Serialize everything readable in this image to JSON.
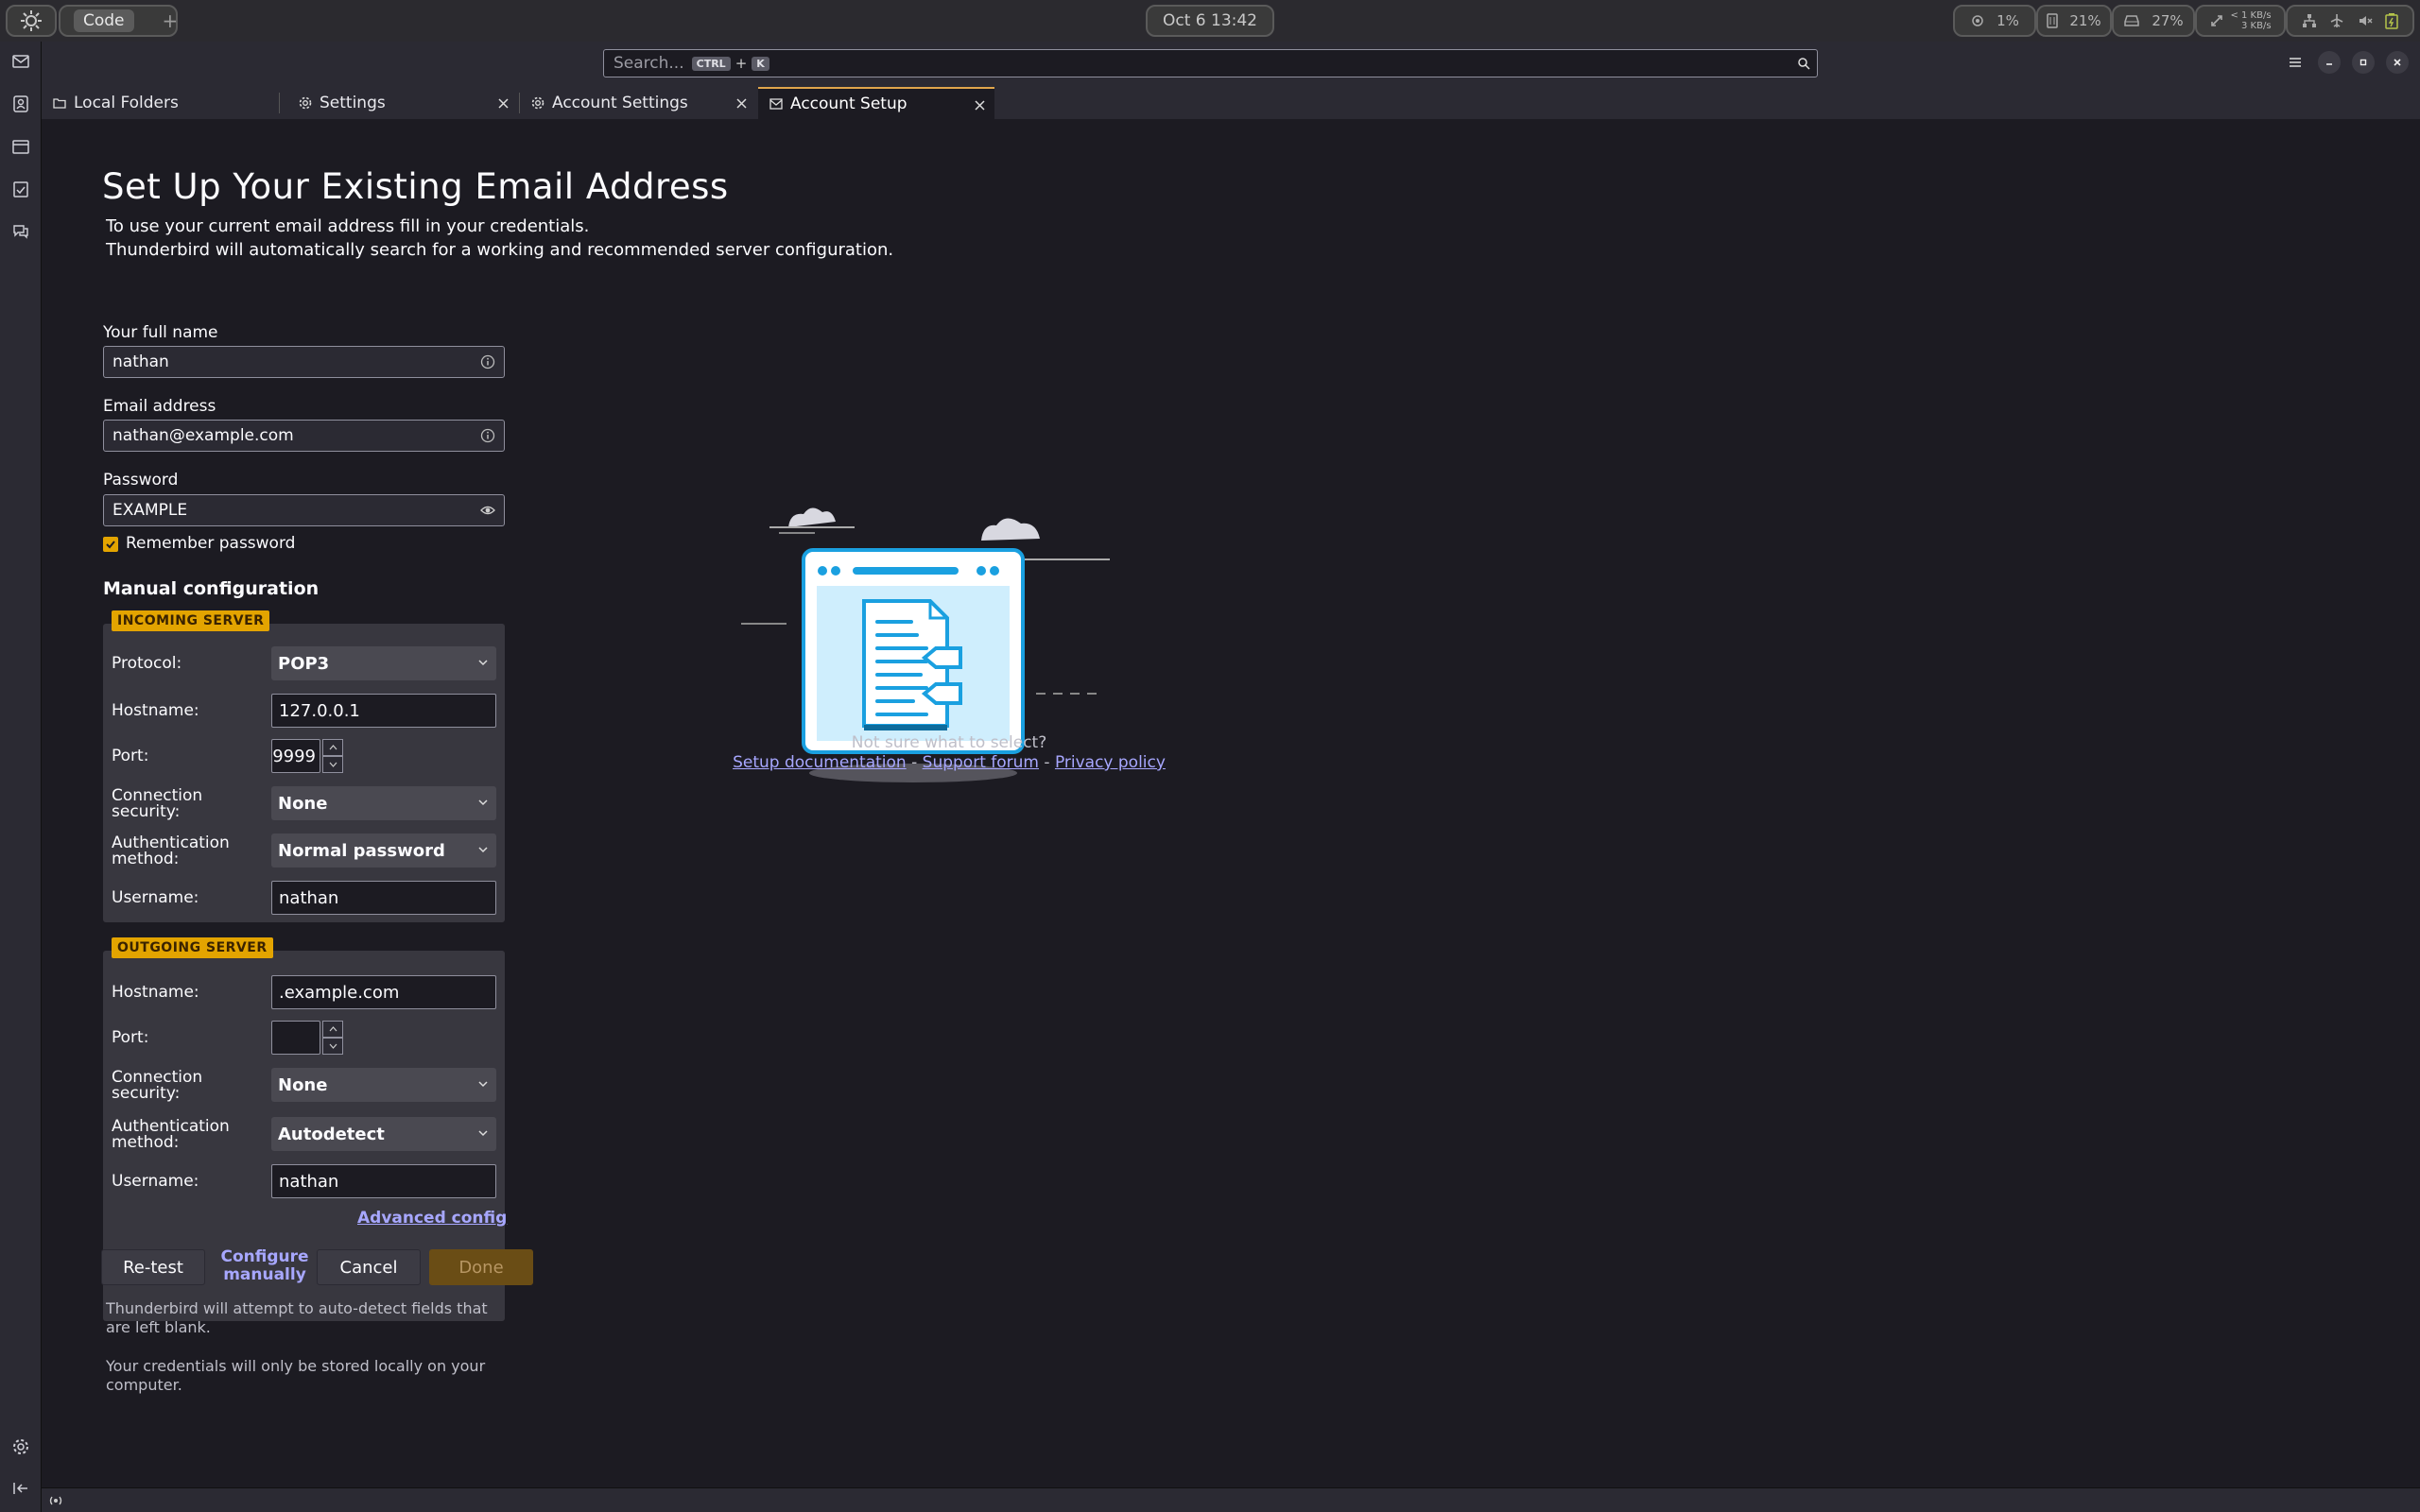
{
  "system_bar": {
    "workspace_label": "Code",
    "workspace_add": "+",
    "clock": "Oct 6  13:42",
    "cpu": "1%",
    "memory": "21%",
    "disk": "27%",
    "net_up": "< 1 KB/s",
    "net_down": "3 KB/s"
  },
  "search": {
    "placeholder": "Search...",
    "key1": "CTRL",
    "plus": "+",
    "key2": "K"
  },
  "tabs": [
    {
      "label": "Local Folders",
      "icon": "folder-icon"
    },
    {
      "label": "Settings",
      "icon": "gear-icon"
    },
    {
      "label": "Account Settings",
      "icon": "account-settings-icon"
    },
    {
      "label": "Account Setup",
      "icon": "mail-icon"
    }
  ],
  "page": {
    "title": "Set Up Your Existing Email Address",
    "intro_line1": "To use your current email address fill in your credentials.",
    "intro_line2": "Thunderbird will automatically search for a working and recommended server configuration."
  },
  "form": {
    "full_name_label": "Your full name",
    "full_name_value": "nathan",
    "email_label": "Email address",
    "email_value": "nathan@example.com",
    "password_label": "Password",
    "password_value": "EXAMPLE",
    "remember_label": "Remember password",
    "remember_checked": true
  },
  "manual": {
    "title": "Manual configuration",
    "incoming": {
      "badge": "INCOMING SERVER",
      "protocol_label": "Protocol:",
      "protocol_value": "POP3",
      "hostname_label": "Hostname:",
      "hostname_value": "127.0.0.1",
      "port_label": "Port:",
      "port_value": "9999",
      "security_label_1": "Connection",
      "security_label_2": "security:",
      "security_value": "None",
      "auth_label_1": "Authentication",
      "auth_label_2": "method:",
      "auth_value": "Normal password",
      "username_label": "Username:",
      "username_value": "nathan"
    },
    "outgoing": {
      "badge": "OUTGOING SERVER",
      "hostname_label": "Hostname:",
      "hostname_value": ".example.com",
      "port_label": "Port:",
      "port_value": "",
      "security_label_1": "Connection",
      "security_label_2": "security:",
      "security_value": "None",
      "auth_label_1": "Authentication",
      "auth_label_2": "method:",
      "auth_value": "Autodetect",
      "username_label": "Username:",
      "username_value": "nathan"
    },
    "advanced_link": "Advanced config"
  },
  "buttons": {
    "retest": "Re-test",
    "configure_1": "Configure",
    "configure_2": "manually",
    "cancel": "Cancel",
    "done": "Done"
  },
  "notes": {
    "autodetect": "Thunderbird will attempt to auto-detect fields that are left blank.",
    "credentials": "Your credentials will only be stored locally on your computer."
  },
  "help": {
    "question": "Not sure what to select?",
    "setup_doc": "Setup documentation",
    "dash": "-",
    "support": "Support forum",
    "privacy": "Privacy policy"
  },
  "colors": {
    "accent": "#e3a400",
    "link": "#a7a7ff",
    "background": "#1c1b22",
    "panel": "#38373f"
  }
}
